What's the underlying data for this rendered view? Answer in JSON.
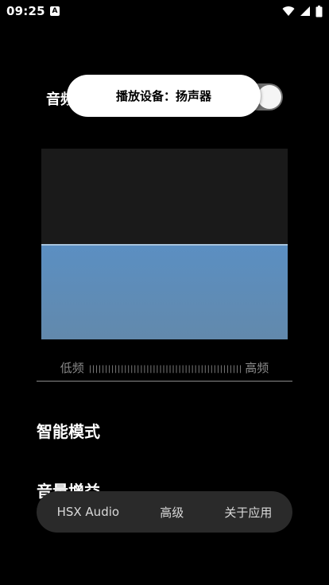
{
  "status": {
    "time": "09:25",
    "notif_letter": "A"
  },
  "sound_switch": {
    "label": "音频",
    "on": true
  },
  "toast": {
    "text": "播放设备：扬声器"
  },
  "equalizer": {
    "level": 0.5
  },
  "freq_bar": {
    "low": "低频",
    "ticks": "||||||||||||||||||||||||||||||||||||||||||||||||",
    "high": "高频"
  },
  "menu": {
    "smart_mode": "智能模式",
    "volume_gain": "音量增益"
  },
  "nav": {
    "items": [
      "HSX Audio",
      "高级",
      "关于应用"
    ]
  },
  "colors": {
    "accent": "#5b8fc2",
    "toast_bg": "#ffffff",
    "nav_bg": "#2a2a2a"
  }
}
